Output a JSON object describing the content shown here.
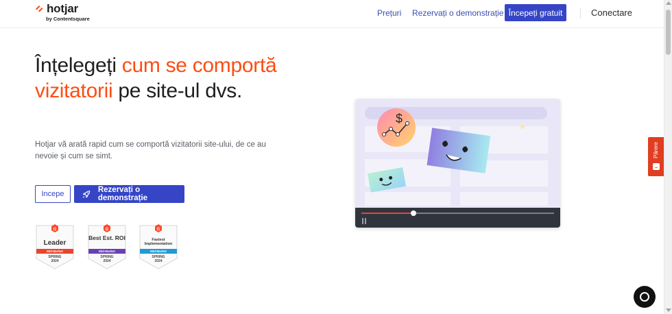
{
  "header": {
    "logo_text": "hotjar",
    "logo_sub": "by Contentsquare",
    "nav_prices": "Prețuri",
    "nav_demo": "Rezervați o demonstrație",
    "cta": "Începeți gratuit",
    "login": "Conectare"
  },
  "hero": {
    "headline_part1": "Înțelegeți ",
    "headline_accent": "cum se comportă vizitatorii",
    "headline_part2": " pe site-ul dvs.",
    "subtext": "Hotjar vă arată rapid cum se comportă vizitatorii site-ului, de ce au nevoie și cum se simt.",
    "btn_start": "Incepe",
    "btn_demo": "Rezervați o demonstrație"
  },
  "badges": [
    {
      "title": "Leader",
      "ribbon": "Mid-Market",
      "season": "SPRING",
      "year": "2024",
      "color": "#e8452c"
    },
    {
      "title": "Best Est. ROI",
      "ribbon": "Mid-Market",
      "season": "SPRING",
      "year": "2024",
      "color": "#6a3fb5"
    },
    {
      "title": "Fastest Implementation",
      "ribbon": "Mid-Market",
      "season": "SPRING",
      "year": "2024",
      "color": "#1f9ad6"
    }
  ],
  "video": {
    "progress": 0.27
  },
  "feedback": {
    "label": "Părere"
  },
  "colors": {
    "accent": "#fd4d12",
    "primary": "#3545c6",
    "feedback": "#e13d21"
  },
  "icons": {
    "logo": "hotjar-logo-icon",
    "rocket": "rocket-icon",
    "pause": "pause-icon",
    "chat": "chat-icon",
    "feedback": "feedback-smile-icon"
  }
}
